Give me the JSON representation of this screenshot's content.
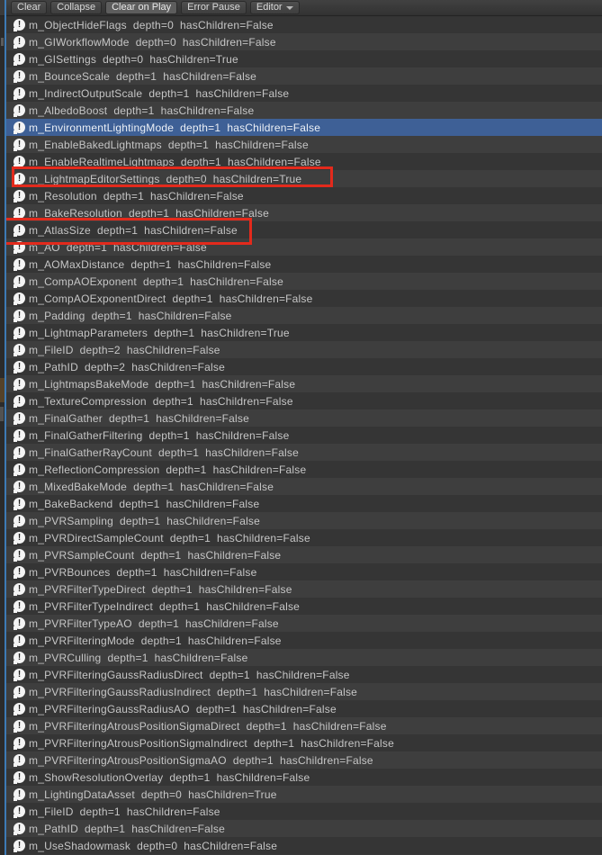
{
  "toolbar": {
    "clear_label": "Clear",
    "collapse_label": "Collapse",
    "clear_on_play_label": "Clear on Play",
    "clear_on_play_active": true,
    "error_pause_label": "Error Pause",
    "editor_label": "Editor"
  },
  "console": {
    "selected_index": 6,
    "rows": [
      {
        "text": "m_ObjectHideFlags  depth=0  hasChildren=False"
      },
      {
        "text": "m_GIWorkflowMode  depth=0  hasChildren=False"
      },
      {
        "text": "m_GISettings  depth=0  hasChildren=True"
      },
      {
        "text": "m_BounceScale  depth=1  hasChildren=False"
      },
      {
        "text": "m_IndirectOutputScale  depth=1  hasChildren=False"
      },
      {
        "text": "m_AlbedoBoost  depth=1  hasChildren=False"
      },
      {
        "text": "m_EnvironmentLightingMode  depth=1  hasChildren=False",
        "selected": true
      },
      {
        "text": "m_EnableBakedLightmaps  depth=1  hasChildren=False"
      },
      {
        "text": "m_EnableRealtimeLightmaps  depth=1  hasChildren=False"
      },
      {
        "text": "m_LightmapEditorSettings  depth=0  hasChildren=True",
        "red_boxed": true
      },
      {
        "text": "m_Resolution  depth=1  hasChildren=False"
      },
      {
        "text": "m_BakeResolution  depth=1  hasChildren=False"
      },
      {
        "text": "m_AtlasSize  depth=1  hasChildren=False",
        "red_boxed": true
      },
      {
        "text": "m_AO  depth=1  hasChildren=False"
      },
      {
        "text": "m_AOMaxDistance  depth=1  hasChildren=False"
      },
      {
        "text": "m_CompAOExponent  depth=1  hasChildren=False"
      },
      {
        "text": "m_CompAOExponentDirect  depth=1  hasChildren=False"
      },
      {
        "text": "m_Padding  depth=1  hasChildren=False"
      },
      {
        "text": "m_LightmapParameters  depth=1  hasChildren=True"
      },
      {
        "text": "m_FileID  depth=2  hasChildren=False"
      },
      {
        "text": "m_PathID  depth=2  hasChildren=False"
      },
      {
        "text": "m_LightmapsBakeMode  depth=1  hasChildren=False"
      },
      {
        "text": "m_TextureCompression  depth=1  hasChildren=False"
      },
      {
        "text": "m_FinalGather  depth=1  hasChildren=False"
      },
      {
        "text": "m_FinalGatherFiltering  depth=1  hasChildren=False"
      },
      {
        "text": "m_FinalGatherRayCount  depth=1  hasChildren=False"
      },
      {
        "text": "m_ReflectionCompression  depth=1  hasChildren=False"
      },
      {
        "text": "m_MixedBakeMode  depth=1  hasChildren=False"
      },
      {
        "text": "m_BakeBackend  depth=1  hasChildren=False"
      },
      {
        "text": "m_PVRSampling  depth=1  hasChildren=False"
      },
      {
        "text": "m_PVRDirectSampleCount  depth=1  hasChildren=False"
      },
      {
        "text": "m_PVRSampleCount  depth=1  hasChildren=False"
      },
      {
        "text": "m_PVRBounces  depth=1  hasChildren=False"
      },
      {
        "text": "m_PVRFilterTypeDirect  depth=1  hasChildren=False"
      },
      {
        "text": "m_PVRFilterTypeIndirect  depth=1  hasChildren=False"
      },
      {
        "text": "m_PVRFilterTypeAO  depth=1  hasChildren=False"
      },
      {
        "text": "m_PVRFilteringMode  depth=1  hasChildren=False"
      },
      {
        "text": "m_PVRCulling  depth=1  hasChildren=False"
      },
      {
        "text": "m_PVRFilteringGaussRadiusDirect  depth=1  hasChildren=False"
      },
      {
        "text": "m_PVRFilteringGaussRadiusIndirect  depth=1  hasChildren=False"
      },
      {
        "text": "m_PVRFilteringGaussRadiusAO  depth=1  hasChildren=False"
      },
      {
        "text": "m_PVRFilteringAtrousPositionSigmaDirect  depth=1  hasChildren=False"
      },
      {
        "text": "m_PVRFilteringAtrousPositionSigmaIndirect  depth=1  hasChildren=False"
      },
      {
        "text": "m_PVRFilteringAtrousPositionSigmaAO  depth=1  hasChildren=False"
      },
      {
        "text": "m_ShowResolutionOverlay  depth=1  hasChildren=False"
      },
      {
        "text": "m_LightingDataAsset  depth=0  hasChildren=True"
      },
      {
        "text": "m_FileID  depth=1  hasChildren=False"
      },
      {
        "text": "m_PathID  depth=1  hasChildren=False"
      },
      {
        "text": "m_UseShadowmask  depth=0  hasChildren=False"
      }
    ]
  },
  "annotations": {
    "box_color": "#e32a1c",
    "boxes": [
      {
        "marks_row_index": 9,
        "marks": "m_LightmapEditorSettings"
      },
      {
        "marks_row_index": 12,
        "marks": "m_AtlasSize"
      }
    ]
  },
  "colors": {
    "selection_blue": "#3e6096",
    "row_dark": "#353535",
    "row_light": "#3e3e3e",
    "divider_blue": "#3d7ab5",
    "toolbar_bg": "#3a3a3a"
  }
}
